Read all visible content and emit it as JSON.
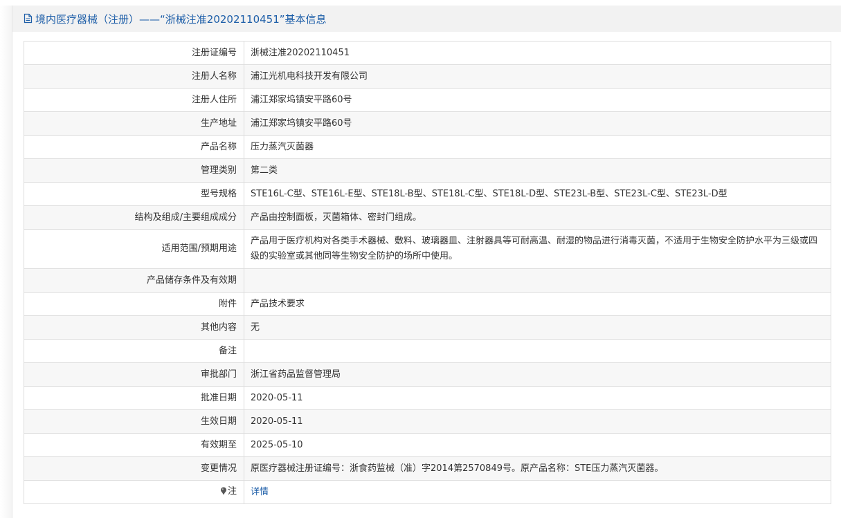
{
  "header": {
    "title": "境内医疗器械（注册）——“浙械注准20202110451”基本信息"
  },
  "rows": [
    {
      "label": "注册证编号",
      "value": "浙械注准20202110451"
    },
    {
      "label": "注册人名称",
      "value": "浦江光机电科技开发有限公司"
    },
    {
      "label": "注册人住所",
      "value": "浦江郑家坞镇安平路60号"
    },
    {
      "label": "生产地址",
      "value": "浦江郑家坞镇安平路60号"
    },
    {
      "label": "产品名称",
      "value": "压力蒸汽灭菌器"
    },
    {
      "label": "管理类别",
      "value": "第二类"
    },
    {
      "label": "型号规格",
      "value": "STE16L-C型、STE16L-E型、STE18L-B型、STE18L-C型、STE18L-D型、STE23L-B型、STE23L-C型、STE23L-D型"
    },
    {
      "label": "结构及组成/主要组成成分",
      "value": "产品由控制面板，灭菌箱体、密封门组成。"
    },
    {
      "label": "适用范围/预期用途",
      "value": "产品用于医疗机构对各类手术器械、敷料、玻璃器皿、注射器具等可耐高温、耐湿的物品进行消毒灭菌，不适用于生物安全防护水平为三级或四级的实验室或其他同等生物安全防护的场所中使用。"
    },
    {
      "label": "产品储存条件及有效期",
      "value": ""
    },
    {
      "label": "附件",
      "value": "产品技术要求"
    },
    {
      "label": "其他内容",
      "value": "无"
    },
    {
      "label": "备注",
      "value": ""
    },
    {
      "label": "审批部门",
      "value": "浙江省药品监督管理局"
    },
    {
      "label": "批准日期",
      "value": "2020-05-11"
    },
    {
      "label": "生效日期",
      "value": "2020-05-11"
    },
    {
      "label": "有效期至",
      "value": "2025-05-10"
    },
    {
      "label": "变更情况",
      "value": "原医疗器械注册证编号：浙食药监械（准）字2014第2570849号。原产品名称：STE压力蒸汽灭菌器。"
    }
  ],
  "note": {
    "label": "注",
    "link_text": "详情",
    "icon": "pin-icon"
  },
  "colors": {
    "header_text": "#1d5ea8",
    "header_bg": "#f2f2f2",
    "border": "#dcdcdc",
    "stripe": "#f7f7f7",
    "link": "#1d5ea8"
  }
}
